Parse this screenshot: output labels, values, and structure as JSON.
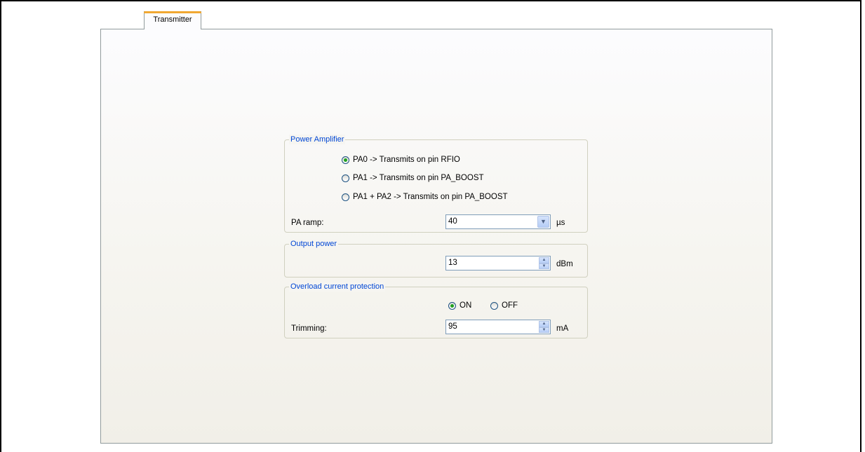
{
  "tabs": [
    {
      "label": "Transmitter",
      "active": true
    }
  ],
  "power_amplifier": {
    "legend": "Power Amplifier",
    "options": [
      {
        "label": "PA0 -> Transmits on pin RFIO",
        "selected": true
      },
      {
        "label": "PA1 -> Transmits on pin PA_BOOST",
        "selected": false
      },
      {
        "label": "PA1 + PA2 -> Transmits on pin PA_BOOST",
        "selected": false
      }
    ],
    "ramp_label": "PA ramp:",
    "ramp_value": "40",
    "ramp_unit": "µs"
  },
  "output_power": {
    "legend": "Output power",
    "value": "13",
    "unit": "dBm"
  },
  "ocp": {
    "legend": "Overload current protection",
    "on_label": "ON",
    "off_label": "OFF",
    "on_selected": true,
    "trimming_label": "Trimming:",
    "trimming_value": "95",
    "trimming_unit": "mA"
  },
  "colors": {
    "legend_text": "#0046d5",
    "tab_accent": "#f1a832",
    "radio_dot": "#21a121"
  }
}
